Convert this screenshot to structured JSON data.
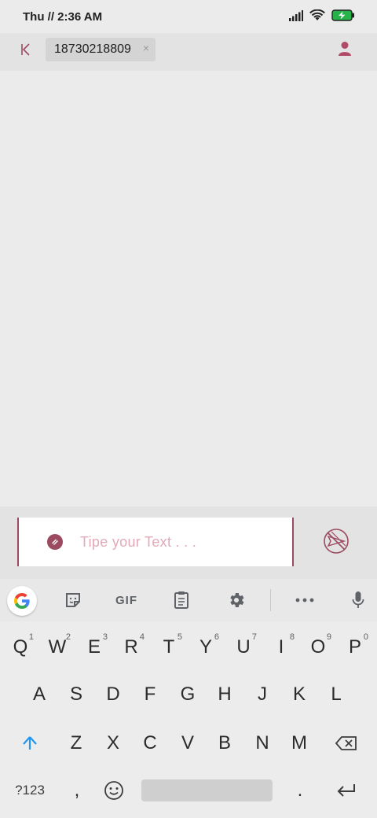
{
  "status_bar": {
    "time": "Thu // 2:36 AM",
    "icons": [
      "signal-icon",
      "wifi-icon",
      "battery-charging-icon"
    ],
    "battery_color": "#27b24a"
  },
  "header": {
    "back_icon": "back-icon",
    "recipient": "18730218809",
    "chip_remove": "×",
    "contact_icon": "person-icon"
  },
  "composer": {
    "placeholder": "Tipe your Text . . .",
    "attach_icon": "attach-icon",
    "send_icon": "send-disabled-icon",
    "accent_color": "#9b4a5f"
  },
  "keyboard_toolbar": {
    "items": [
      "google-icon",
      "sticker-icon",
      "gif",
      "clipboard-icon",
      "settings-icon",
      "more-icon",
      "mic-icon"
    ],
    "gif_label": "GIF"
  },
  "keyboard": {
    "row1": [
      {
        "key": "Q",
        "hint": "1"
      },
      {
        "key": "W",
        "hint": "2"
      },
      {
        "key": "E",
        "hint": "3"
      },
      {
        "key": "R",
        "hint": "4"
      },
      {
        "key": "T",
        "hint": "5"
      },
      {
        "key": "Y",
        "hint": "6"
      },
      {
        "key": "U",
        "hint": "7"
      },
      {
        "key": "I",
        "hint": "8"
      },
      {
        "key": "O",
        "hint": "9"
      },
      {
        "key": "P",
        "hint": "0"
      }
    ],
    "row2": [
      "A",
      "S",
      "D",
      "F",
      "G",
      "H",
      "J",
      "K",
      "L"
    ],
    "row3": [
      "Z",
      "X",
      "C",
      "V",
      "B",
      "N",
      "M"
    ],
    "symbols_label": "?123",
    "comma": ",",
    "period": ".",
    "emoji_icon": "emoji-icon",
    "shift_icon": "shift-icon",
    "backspace_icon": "backspace-icon",
    "enter_icon": "enter-icon"
  }
}
